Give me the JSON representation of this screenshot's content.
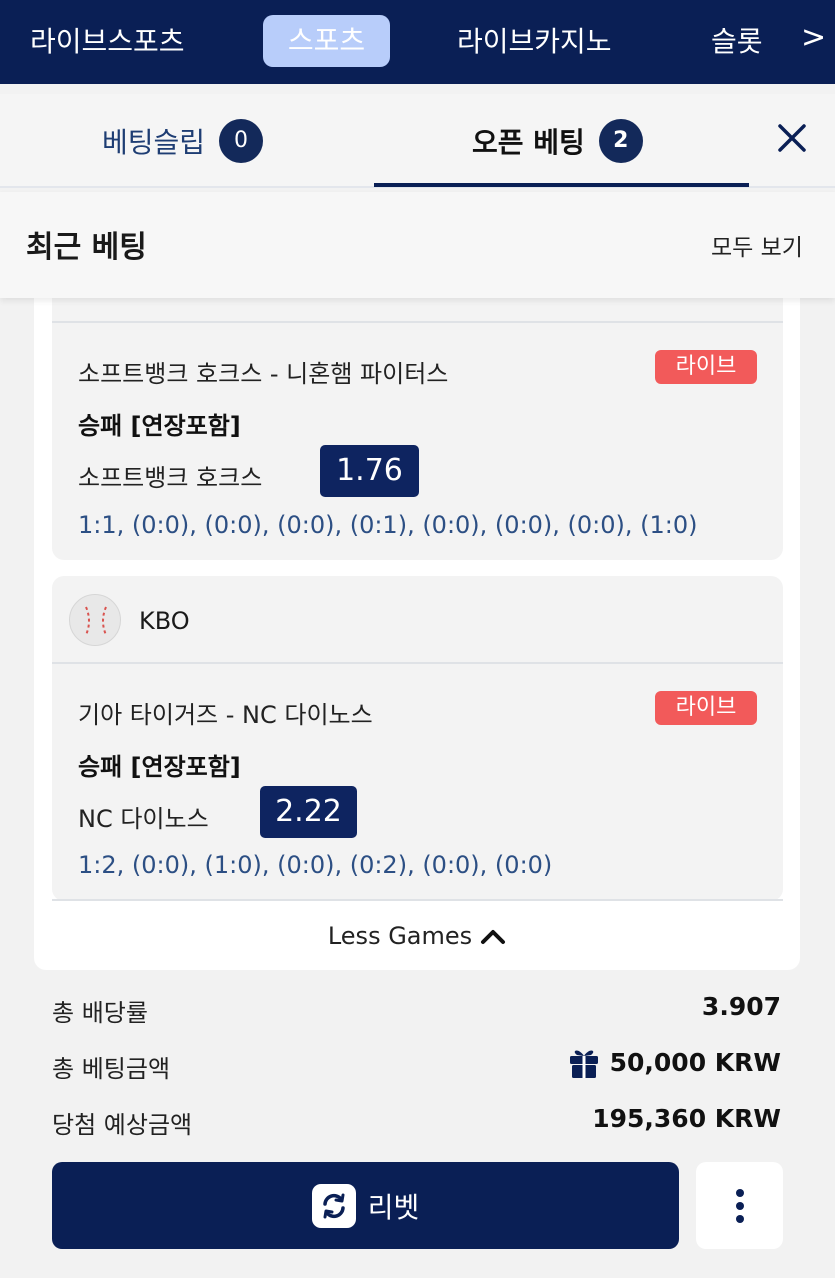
{
  "topnav": {
    "items": [
      "라이브스포츠",
      "스포츠",
      "라이브카지노",
      "슬롯"
    ],
    "active": "스포츠",
    "more": ">"
  },
  "tabs": {
    "slip_label": "베팅슬립",
    "slip_count": "0",
    "open_label": "오픈 베팅",
    "open_count": "2"
  },
  "recent": {
    "title": "최근 베팅",
    "see_all": "모두 보기"
  },
  "bets": [
    {
      "match": "소프트뱅크 호크스 - 니혼햄 파이터스",
      "status": "라이브",
      "market": "승패 [연장포함]",
      "pick": "소프트뱅크 호크스",
      "odds": "1.76",
      "scores": "1:1, (0:0), (0:0), (0:0), (0:1), (0:0), (0:0), (0:0), (1:0)"
    },
    {
      "league": "KBO",
      "match": "기아 타이거즈 - NC 다이노스",
      "status": "라이브",
      "market": "승패 [연장포함]",
      "pick": "NC 다이노스",
      "odds": "2.22",
      "scores": "1:2, (0:0), (1:0), (0:0), (0:2), (0:0), (0:0)"
    }
  ],
  "less_games": "Less Games",
  "summary": {
    "total_odds_label": "총 배당률",
    "total_odds": "3.907",
    "total_stake_label": "총 베팅금액",
    "total_stake": "50,000 KRW",
    "potential_win_label": "당첨 예상금액",
    "potential_win": "195,360 KRW"
  },
  "rebet_label": "리벳",
  "colors": {
    "navy": "#0a1f55",
    "live": "#f25a5a",
    "score_text": "#2c4f84"
  }
}
